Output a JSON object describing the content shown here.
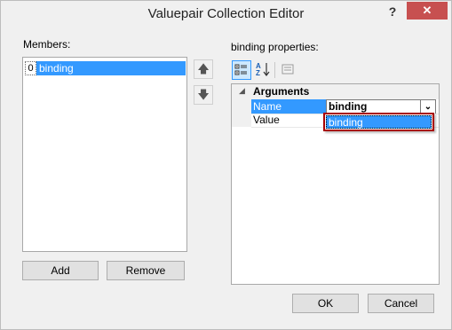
{
  "window": {
    "title": "Valuepair Collection Editor",
    "help_label": "?",
    "close_label": "✕"
  },
  "members": {
    "label": "Members:",
    "items": [
      {
        "index": "0",
        "label": "binding"
      }
    ]
  },
  "side_buttons": {
    "up_label": "🡅",
    "down_label": "🡇"
  },
  "buttons": {
    "add": "Add",
    "remove": "Remove",
    "ok": "OK",
    "cancel": "Cancel"
  },
  "properties": {
    "label": "binding properties:",
    "toolbar": {
      "categorized_icon": "categorized-icon",
      "alphabetical_icon": "alphabetical-icon",
      "property_pages_icon": "property-pages-icon"
    },
    "category": {
      "arrow": "◢",
      "label": "Arguments"
    },
    "rows": [
      {
        "name": "Name",
        "value": "binding",
        "selected": true
      },
      {
        "name": "Value",
        "value": ""
      }
    ],
    "combo_arrow": "⌄",
    "dropdown_options": [
      "binding"
    ]
  },
  "colors": {
    "selection": "#3399ff",
    "close_button": "#c75050",
    "dropdown_border": "#a80000"
  }
}
